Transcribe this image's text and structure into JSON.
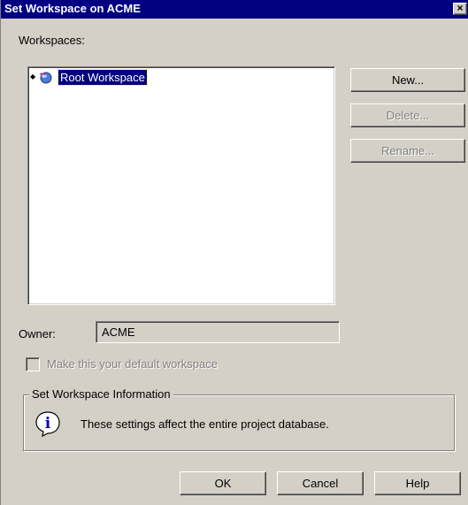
{
  "window": {
    "title": "Set Workspace on ACME",
    "close_glyph": "×"
  },
  "workspaces": {
    "label": "Workspaces:",
    "items": [
      {
        "label": "Root Workspace",
        "selected": true,
        "icon": "workspace-globe-icon",
        "expander": "◆"
      }
    ]
  },
  "buttons": {
    "new": "New...",
    "delete": "Delete...",
    "rename": "Rename...",
    "ok": "OK",
    "cancel": "Cancel",
    "help": "Help"
  },
  "owner": {
    "label": "Owner:",
    "value": "ACME"
  },
  "default_checkbox": {
    "label": "Make this your default workspace",
    "checked": false,
    "enabled": false
  },
  "info_group": {
    "title": "Set Workspace Information",
    "icon": "info-icon",
    "glyph": "i",
    "message": "These settings affect the entire project database."
  },
  "colors": {
    "title_bar": "#000080",
    "face": "#d4d0c8",
    "selection": "#000080"
  }
}
